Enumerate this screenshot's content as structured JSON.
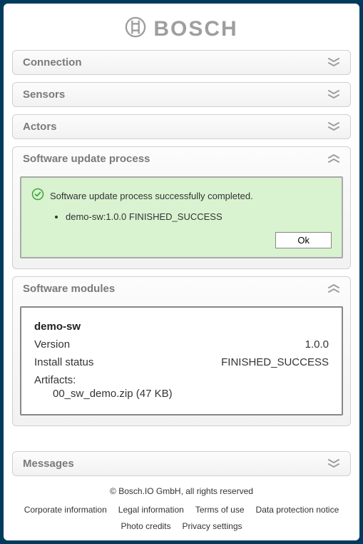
{
  "brand": "BOSCH",
  "sections": {
    "connection": {
      "title": "Connection"
    },
    "sensors": {
      "title": "Sensors"
    },
    "actors": {
      "title": "Actors"
    },
    "update": {
      "title": "Software update process",
      "message": "Software update process successfully completed.",
      "items": [
        "demo-sw:1.0.0 FINISHED_SUCCESS"
      ],
      "ok_label": "Ok"
    },
    "modules": {
      "title": "Software modules",
      "module": {
        "name": "demo-sw",
        "version_label": "Version",
        "version": "1.0.0",
        "status_label": "Install status",
        "status": "FINISHED_SUCCESS",
        "artifacts_label": "Artifacts:",
        "artifact": "00_sw_demo.zip (47 KB)"
      }
    },
    "messages": {
      "title": "Messages"
    }
  },
  "footer": {
    "copyright": "© Bosch.IO GmbH, all rights reserved",
    "links": [
      "Corporate information",
      "Legal information",
      "Terms of use",
      "Data protection notice",
      "Photo credits",
      "Privacy settings"
    ]
  }
}
